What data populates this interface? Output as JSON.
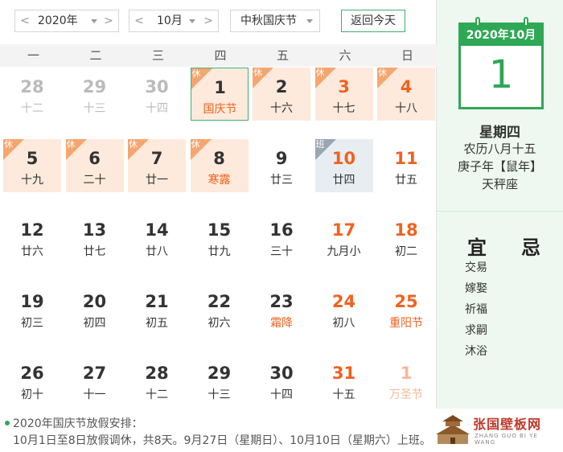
{
  "toolbar": {
    "year": "2020年",
    "month": "10月",
    "holiday": "中秋国庆节",
    "today_button": "返回今天",
    "prev_arrow": "<",
    "next_arrow": ">"
  },
  "weekdays": [
    "一",
    "二",
    "三",
    "四",
    "五",
    "六",
    "日"
  ],
  "days": [
    {
      "num": "28",
      "lunar": "十二",
      "type": "other"
    },
    {
      "num": "29",
      "lunar": "十三",
      "type": "other"
    },
    {
      "num": "30",
      "lunar": "十四",
      "type": "other"
    },
    {
      "num": "1",
      "lunar": "国庆节",
      "type": "today",
      "badge": "休",
      "festival": true
    },
    {
      "num": "2",
      "lunar": "十六",
      "type": "rest",
      "badge": "休"
    },
    {
      "num": "3",
      "lunar": "十七",
      "type": "rest",
      "badge": "休",
      "weekend": true
    },
    {
      "num": "4",
      "lunar": "十八",
      "type": "rest",
      "badge": "休",
      "weekend": true
    },
    {
      "num": "5",
      "lunar": "十九",
      "type": "rest",
      "badge": "休"
    },
    {
      "num": "6",
      "lunar": "二十",
      "type": "rest",
      "badge": "休"
    },
    {
      "num": "7",
      "lunar": "廿一",
      "type": "rest",
      "badge": "休"
    },
    {
      "num": "8",
      "lunar": "寒露",
      "type": "rest",
      "badge": "休",
      "festival": true
    },
    {
      "num": "9",
      "lunar": "廿三",
      "type": "normal"
    },
    {
      "num": "10",
      "lunar": "廿四",
      "type": "work",
      "badge": "班",
      "weekend": true
    },
    {
      "num": "11",
      "lunar": "廿五",
      "type": "normal",
      "weekend": true
    },
    {
      "num": "12",
      "lunar": "廿六",
      "type": "normal"
    },
    {
      "num": "13",
      "lunar": "廿七",
      "type": "normal"
    },
    {
      "num": "14",
      "lunar": "廿八",
      "type": "normal"
    },
    {
      "num": "15",
      "lunar": "廿九",
      "type": "normal"
    },
    {
      "num": "16",
      "lunar": "三十",
      "type": "normal"
    },
    {
      "num": "17",
      "lunar": "九月小",
      "type": "normal",
      "weekend": true
    },
    {
      "num": "18",
      "lunar": "初二",
      "type": "normal",
      "weekend": true
    },
    {
      "num": "19",
      "lunar": "初三",
      "type": "normal"
    },
    {
      "num": "20",
      "lunar": "初四",
      "type": "normal"
    },
    {
      "num": "21",
      "lunar": "初五",
      "type": "normal"
    },
    {
      "num": "22",
      "lunar": "初六",
      "type": "normal"
    },
    {
      "num": "23",
      "lunar": "霜降",
      "type": "normal",
      "festival": true
    },
    {
      "num": "24",
      "lunar": "初八",
      "type": "normal",
      "weekend": true
    },
    {
      "num": "25",
      "lunar": "重阳节",
      "type": "normal",
      "weekend": true,
      "festival": true
    },
    {
      "num": "26",
      "lunar": "初十",
      "type": "normal"
    },
    {
      "num": "27",
      "lunar": "十一",
      "type": "normal"
    },
    {
      "num": "28",
      "lunar": "十二",
      "type": "normal"
    },
    {
      "num": "29",
      "lunar": "十三",
      "type": "normal"
    },
    {
      "num": "30",
      "lunar": "十四",
      "type": "normal"
    },
    {
      "num": "31",
      "lunar": "十五",
      "type": "normal",
      "weekend": true
    },
    {
      "num": "1",
      "lunar": "万圣节",
      "type": "other",
      "festival": true
    }
  ],
  "side": {
    "calendar_header": "2020年10月",
    "big_day": "1",
    "weekday": "星期四",
    "lunar_date": "农历八月十五",
    "ganzhi": "庚子年【鼠年】",
    "constellation": "天秤座",
    "yi_label": "宜",
    "ji_label": "忌",
    "yi_items": [
      "交易",
      "嫁娶",
      "祈福",
      "求嗣",
      "沐浴"
    ]
  },
  "footer": {
    "line1": "2020年国庆节放假安排：",
    "line2": "10月1日至8日放假调休，共8天。9月27日（星期日）、10月10日（星期六）上班。",
    "logo_text": "张国壁板网",
    "logo_sub": "ZHANG GUO BI YE WANG"
  },
  "colors": {
    "accent_green": "#2ea855",
    "weekend_orange": "#f0621f",
    "rest_bg": "#fdeadc",
    "rest_badge": "#f5a66e",
    "work_badge": "#9aa6b2"
  }
}
